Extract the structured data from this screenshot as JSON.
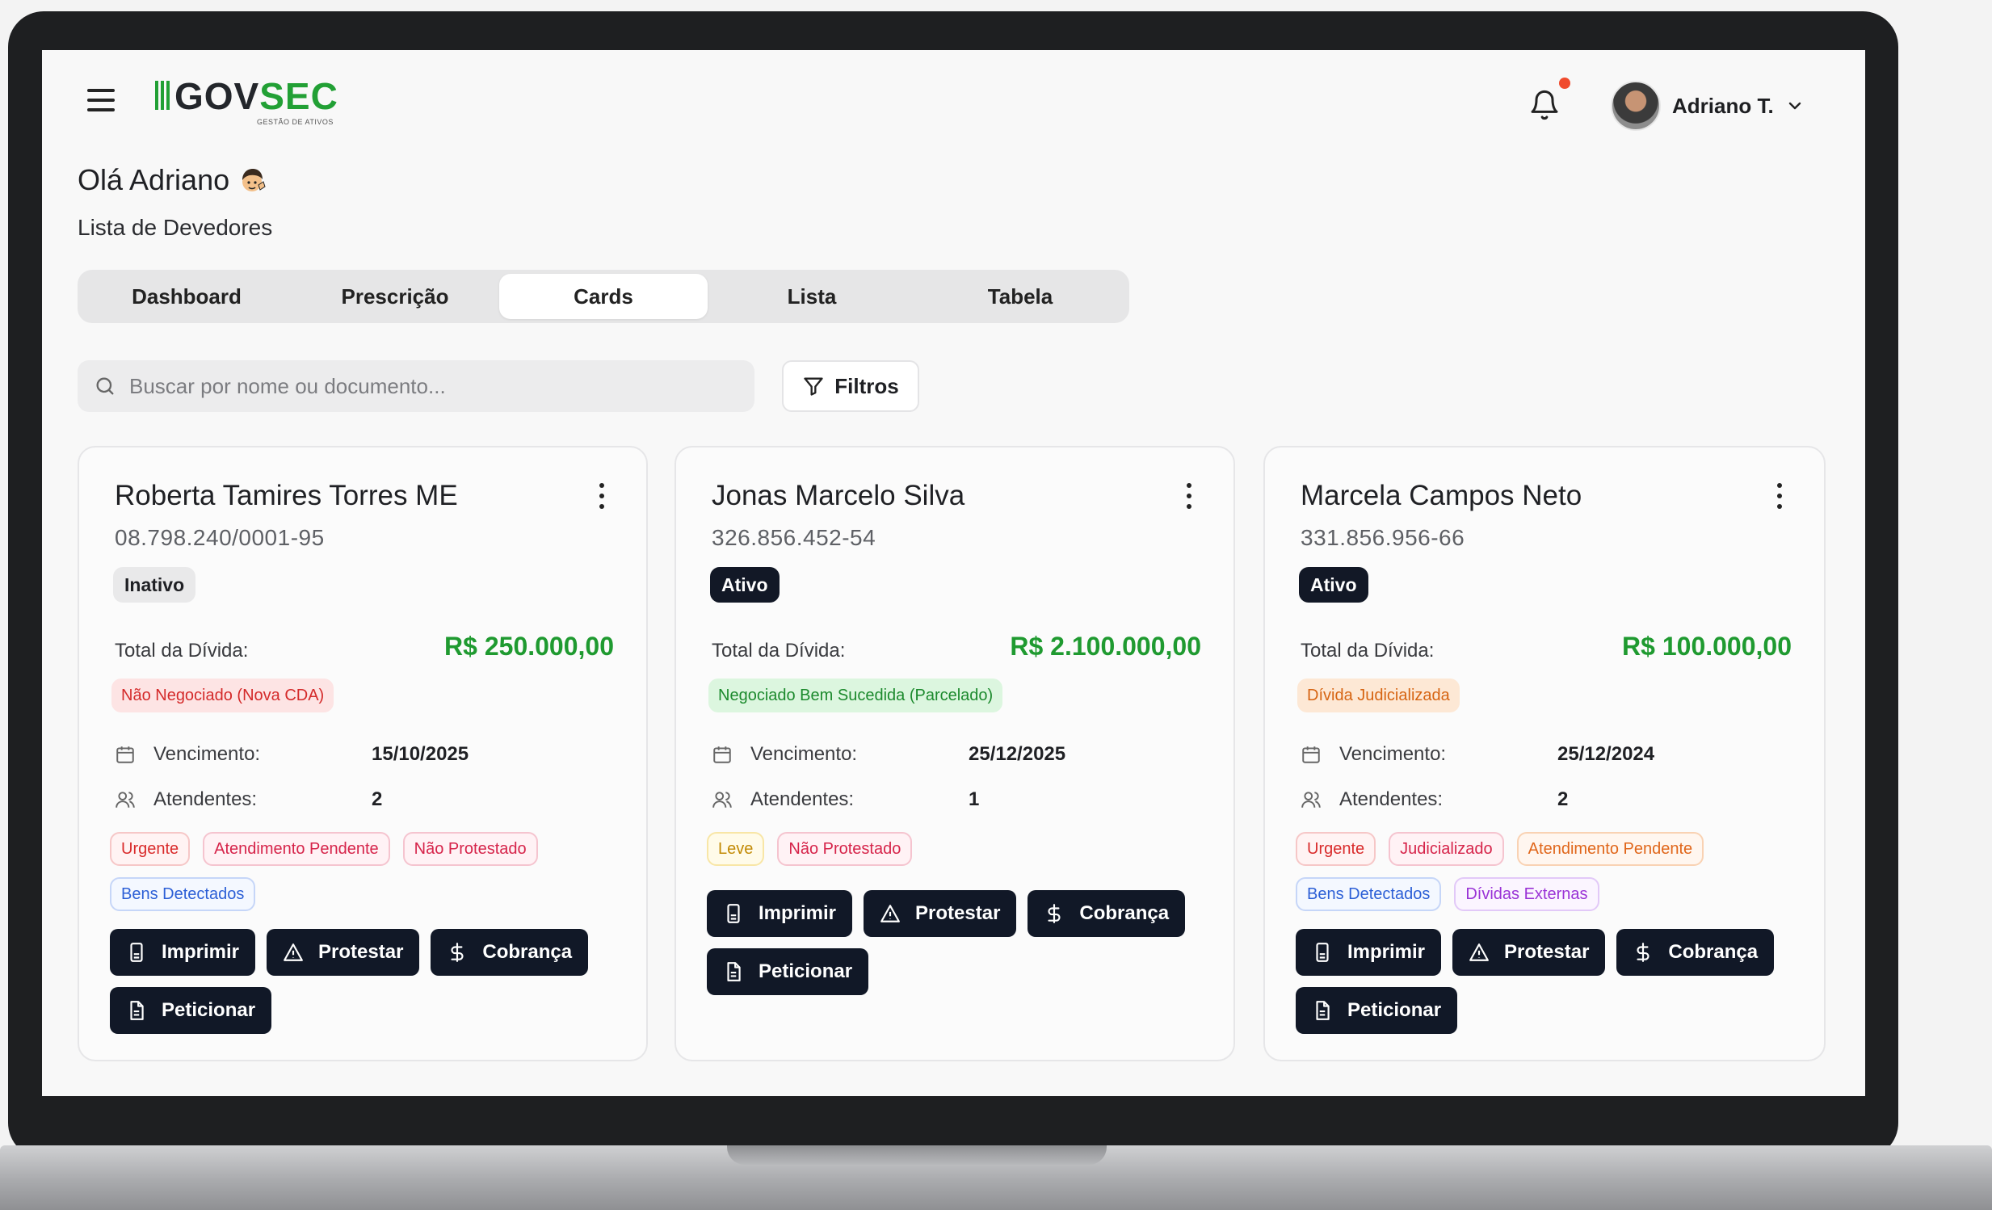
{
  "header": {
    "logo_gov": "GOV",
    "logo_sec": "SEC",
    "logo_tagline": "GESTÃO DE ATIVOS",
    "user_name": "Adriano T."
  },
  "greeting": "Olá Adriano",
  "subtitle": "Lista de Devedores",
  "tabs": [
    {
      "label": "Dashboard"
    },
    {
      "label": "Prescrição"
    },
    {
      "label": "Cards",
      "active": true
    },
    {
      "label": "Lista"
    },
    {
      "label": "Tabela"
    }
  ],
  "search": {
    "placeholder": "Buscar por nome ou documento..."
  },
  "filters_label": "Filtros",
  "labels": {
    "total": "Total da Dívida:",
    "vencimento": "Vencimento:",
    "atendentes": "Atendentes:"
  },
  "actions": {
    "imprimir": "Imprimir",
    "protestar": "Protestar",
    "cobranca": "Cobrança",
    "peticionar": "Peticionar"
  },
  "cards": [
    {
      "name": "Roberta Tamires Torres ME",
      "document": "08.798.240/0001-95",
      "status": "Inativo",
      "total": "R$ 250.000,00",
      "negotiation": "Não Negociado (Nova CDA)",
      "vencimento": "15/10/2025",
      "atendentes": "2",
      "tags": [
        "Urgente",
        "Atendimento Pendente",
        "Não Protestado",
        "Bens Detectados"
      ]
    },
    {
      "name": "Jonas Marcelo Silva",
      "document": "326.856.452-54",
      "status": "Ativo",
      "total": "R$ 2.100.000,00",
      "negotiation": "Negociado Bem Sucedida (Parcelado)",
      "vencimento": "25/12/2025",
      "atendentes": "1",
      "tags": [
        "Leve",
        "Não Protestado"
      ]
    },
    {
      "name": "Marcela Campos Neto",
      "document": "331.856.956-66",
      "status": "Ativo",
      "total": "R$ 100.000,00",
      "negotiation": "Dívida Judicializada",
      "vencimento": "25/12/2024",
      "atendentes": "2",
      "tags": [
        "Urgente",
        "Judicializado",
        "Atendimento Pendente",
        "Bens Detectados",
        "Dívidas Externas"
      ]
    }
  ],
  "colors": {
    "brand_green": "#22a035",
    "dark_button": "#111827",
    "notification_dot": "#f04a2c"
  }
}
